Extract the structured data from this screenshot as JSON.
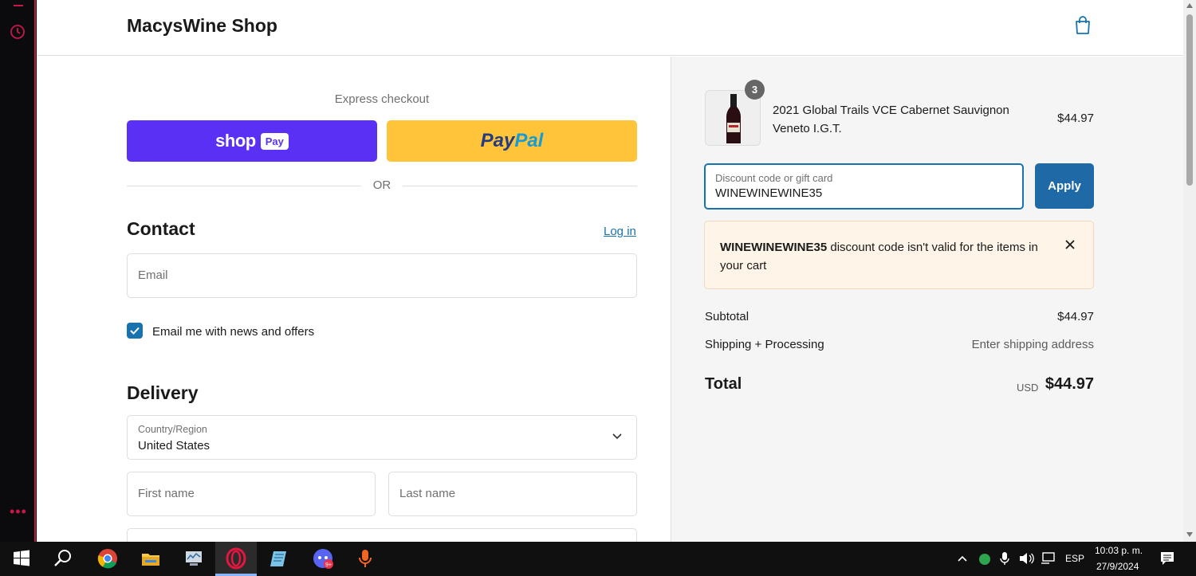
{
  "shop": {
    "name": "MacysWine Shop"
  },
  "express": {
    "label": "Express checkout",
    "shoppay_text": "shop",
    "shoppay_badge": "Pay",
    "paypal_part1": "Pay",
    "paypal_part2": "Pal",
    "or": "OR"
  },
  "contact": {
    "title": "Contact",
    "login": "Log in",
    "email_placeholder": "Email",
    "newsletter_label": "Email me with news and offers",
    "newsletter_checked": true
  },
  "delivery": {
    "title": "Delivery",
    "country_label": "Country/Region",
    "country_value": "United States",
    "first_name_placeholder": "First name",
    "last_name_placeholder": "Last name"
  },
  "order": {
    "item": {
      "name": "2021 Global Trails VCE Cabernet Sauvignon Veneto I.G.T.",
      "quantity": "3",
      "price": "$44.97"
    },
    "discount": {
      "label": "Discount code or gift card",
      "value": "WINEWINEWINE35",
      "apply": "Apply"
    },
    "error": {
      "code": "WINEWINEWINE35",
      "message": " discount code isn't valid for the items in your cart"
    },
    "subtotal_label": "Subtotal",
    "subtotal_value": "$44.97",
    "shipping_label": "Shipping + Processing",
    "shipping_value": "Enter shipping address",
    "total_label": "Total",
    "total_currency": "USD",
    "total_value": "$44.97"
  },
  "taskbar": {
    "lang": "ESP",
    "time": "10:03 p. m.",
    "date": "27/9/2024"
  },
  "colors": {
    "accent": "#1773b0",
    "shoppay": "#5a31f4",
    "paypal": "#ffc439",
    "opera": "#c8184b"
  }
}
